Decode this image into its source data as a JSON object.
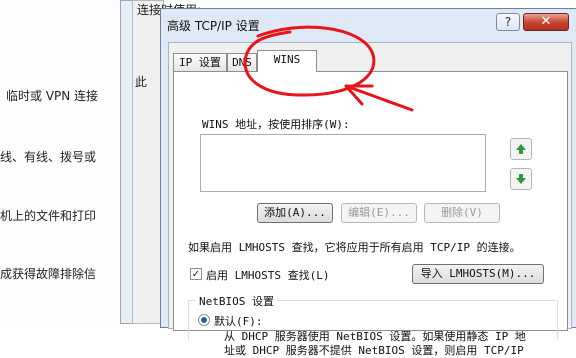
{
  "background": {
    "lines": [
      "临时或 VPN 连接",
      "线、有线、拨号或",
      "机上的文件和打印",
      "成获得故障排除信"
    ],
    "mid_window": {
      "fragment_top": "连接时使用:",
      "fragment_side": "此"
    }
  },
  "dialog": {
    "title": "高级 TCP/IP 设置",
    "help_label": "?",
    "close_label": "✕",
    "tabs": [
      {
        "label": "IP 设置",
        "active": false
      },
      {
        "label": "DNS",
        "active": false
      },
      {
        "label": "WINS",
        "active": true
      }
    ],
    "wins": {
      "list_label": "WINS 地址，按使用排序(W):",
      "add_button": "添加(A)...",
      "edit_button": "编辑(E)...",
      "remove_button": "删除(V)",
      "lmhosts_note": "如果启用 LMHOSTS 查找，它将应用于所有启用 TCP/IP 的连接。",
      "enable_lmhosts": {
        "label": "启用 LMHOSTS 查找(L)",
        "checked": true
      },
      "import_button": "导入 LMHOSTS(M)...",
      "netbios": {
        "title": "NetBIOS 设置",
        "default_option": {
          "label": "默认(F):",
          "selected": true
        },
        "default_description_line1": "从 DHCP 服务器使用 NetBIOS 设置。如果使用静态 IP 地",
        "default_description_line2": "址或 DHCP 服务器不提供 NetBIOS 设置，则启用 TCP/IP"
      }
    }
  },
  "colors": {
    "annotation": "#e8141a",
    "arrow_up": "#2f9a3c",
    "close": "#c7432e"
  },
  "icons": {
    "move_up": "up-arrow-icon",
    "move_down": "down-arrow-icon"
  }
}
